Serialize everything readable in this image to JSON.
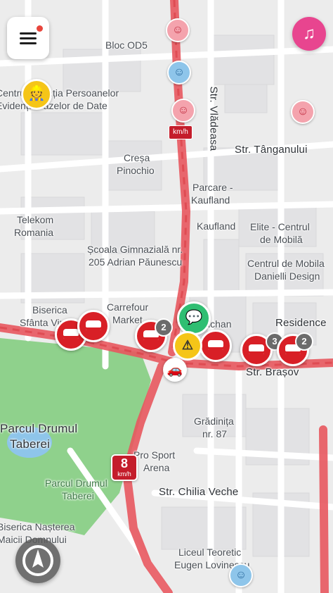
{
  "controls": {
    "menu_icon": "hamburger-menu-icon",
    "music_icon": "music-note-icon",
    "music_glyph": "♫",
    "compass_icon": "recenter-compass-icon",
    "accent_pink": "#e8458f",
    "notification_dot": "#e8453c"
  },
  "map": {
    "labels": {
      "bloc": "Bloc OD5",
      "agentia": "Centrul Agenția Persoanelor",
      "agentia2": "Evidența Bazelor de Date",
      "vladeasa": "Str. Vlădeasa",
      "tanganului": "Str. Tânganului",
      "cresa": "Creșa",
      "cresa2": "Pinochio",
      "parcare": "Parcare -",
      "parcare2": "Kaufland",
      "telekom": "Telekom",
      "telekom2": "Romania",
      "kaufland": "Kaufland",
      "elite": "Elite - Centrul",
      "elite2": "de Mobilă",
      "scoala": "Școala Gimnazială nr.",
      "scoala2": "205 Adrian Păunescu",
      "centrul": "Centrul de Mobila",
      "centrul2": "Danielli Design",
      "biserica": "Biserica",
      "biserica2": "Sfânta Vineri",
      "carrefour": "Carrefour",
      "carrefour2": "Market",
      "auchan": "Auchan",
      "residence": "Residence",
      "brasov": "Str. Brașov",
      "parcul": "Parcul Drumul",
      "parcul2": "Taberei",
      "parcul_small": "Parcul Drumul",
      "parcul_small2": "Taberei",
      "gradinita": "Grădinița",
      "gradinita2": "nr. 87",
      "prosport": "Pro Sport",
      "prosport2": "Arena",
      "chilia": "Str. Chilia Veche",
      "biserica_n": "Biserica Nașterea",
      "biserica_n2": "Maicii Domnului",
      "liceul": "Liceul Teoretic",
      "liceul2": "Eugen Lovinescu"
    },
    "speed": {
      "value": "8",
      "unit": "km/h",
      "small_unit": "km/h"
    },
    "badges": [
      "2",
      "3",
      "2"
    ],
    "colors": {
      "road_jam": "#e8585f",
      "park": "#8fd18c",
      "water": "#8ec5ea",
      "alert": "#d81f26"
    },
    "icons": {
      "hazard_glyph": "⚠",
      "chat_glyph": "💬",
      "worker_glyph": "👷",
      "me_glyph": "🚗",
      "wazer_glyph": "☺"
    }
  }
}
